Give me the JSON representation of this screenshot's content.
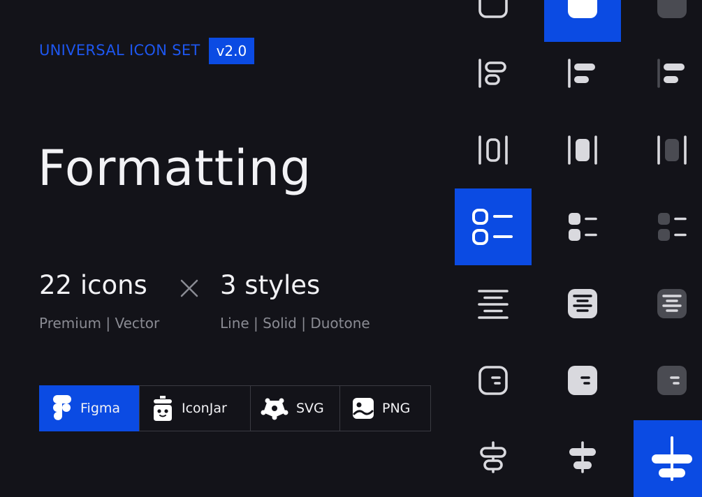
{
  "header": {
    "brand": "UNIVERSAL ICON SET",
    "version": "v2.0"
  },
  "title": "Formatting",
  "stats": {
    "icons": {
      "value": "22 icons",
      "sub": "Premium | Vector"
    },
    "styles": {
      "value": "3 styles",
      "sub": "Line | Solid | Duotone"
    }
  },
  "formats": [
    {
      "label": "Figma",
      "icon": "figma-icon"
    },
    {
      "label": "IconJar",
      "icon": "iconjar-icon"
    },
    {
      "label": "SVG",
      "icon": "svg-icon"
    },
    {
      "label": "PNG",
      "icon": "png-icon"
    }
  ],
  "colors": {
    "background": "#131319",
    "accent": "#0b4be3",
    "line": "#d9d9de",
    "duotone": "#4a4b52"
  }
}
